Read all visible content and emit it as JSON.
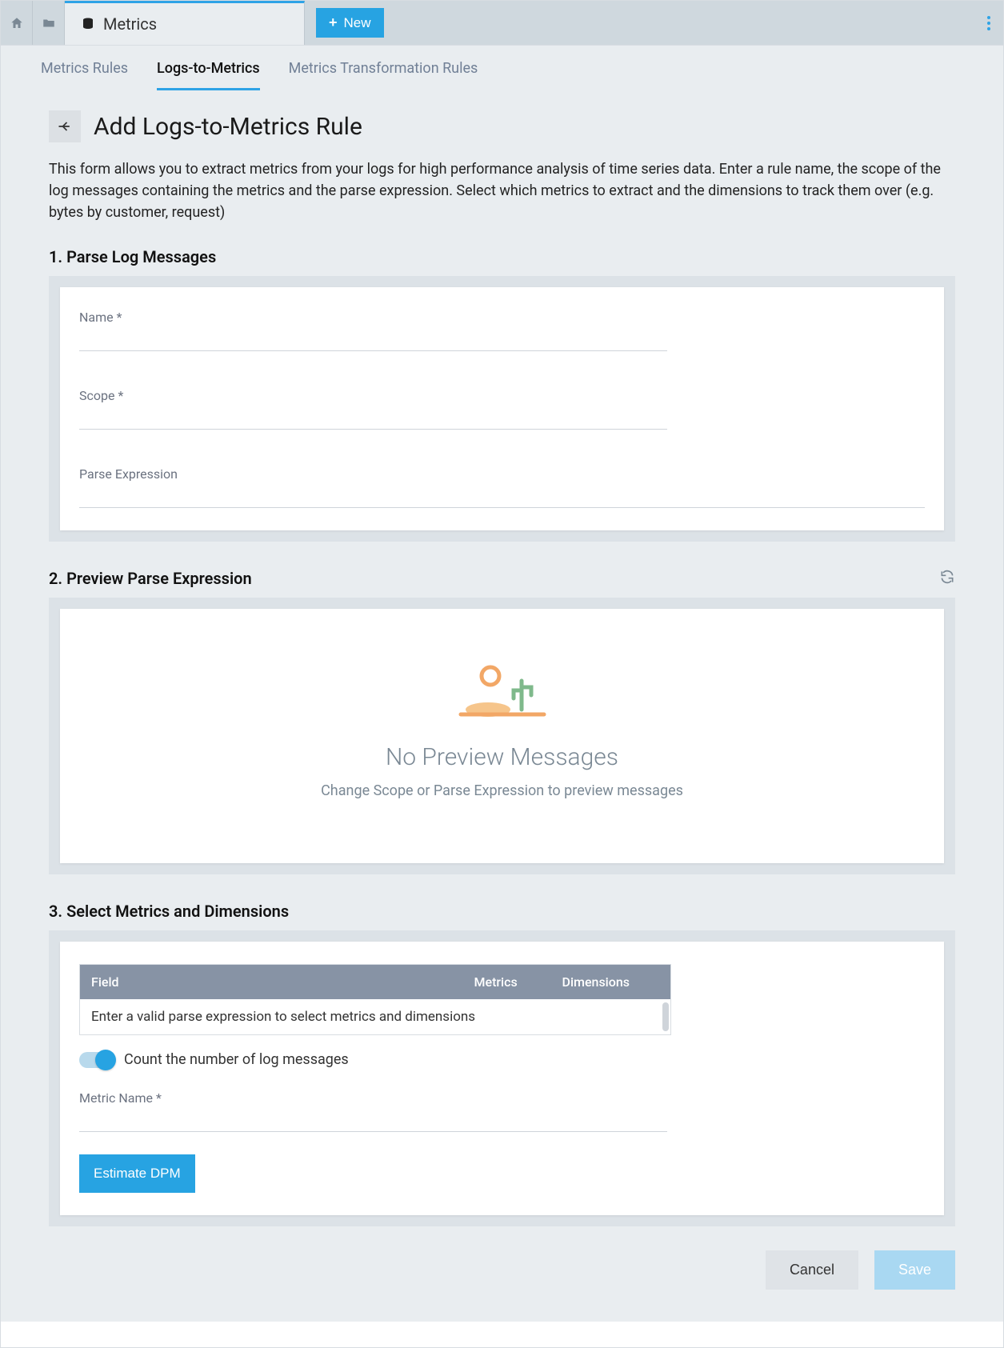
{
  "topbar": {
    "tab_label": "Metrics",
    "new_label": "New"
  },
  "subtabs": {
    "rules": "Metrics Rules",
    "logs_to_metrics": "Logs-to-Metrics",
    "transformation": "Metrics Transformation Rules"
  },
  "header": {
    "title": "Add Logs-to-Metrics Rule",
    "description": "This form allows you to extract metrics from your logs for high performance analysis of time series data. Enter a rule name, the scope of the log messages containing the metrics and the parse expression. Select which metrics to extract and the dimensions to track them over (e.g. bytes by customer, request)"
  },
  "section1": {
    "title": "1. Parse Log Messages",
    "fields": {
      "name_label": "Name *",
      "name_value": "",
      "scope_label": "Scope *",
      "scope_value": "",
      "parse_label": "Parse Expression",
      "parse_value": ""
    }
  },
  "section2": {
    "title": "2. Preview Parse Expression",
    "empty_title": "No Preview Messages",
    "empty_subtitle": "Change Scope or Parse Expression to preview messages"
  },
  "section3": {
    "title": "3. Select Metrics and Dimensions",
    "table": {
      "col_field": "Field",
      "col_metrics": "Metrics",
      "col_dimensions": "Dimensions",
      "empty_row": "Enter a valid parse expression to select metrics and dimensions"
    },
    "toggle_label": "Count the number of log messages",
    "toggle_on": true,
    "metric_name_label": "Metric Name *",
    "metric_name_value": "",
    "estimate_label": "Estimate DPM"
  },
  "footer": {
    "cancel": "Cancel",
    "save": "Save"
  }
}
